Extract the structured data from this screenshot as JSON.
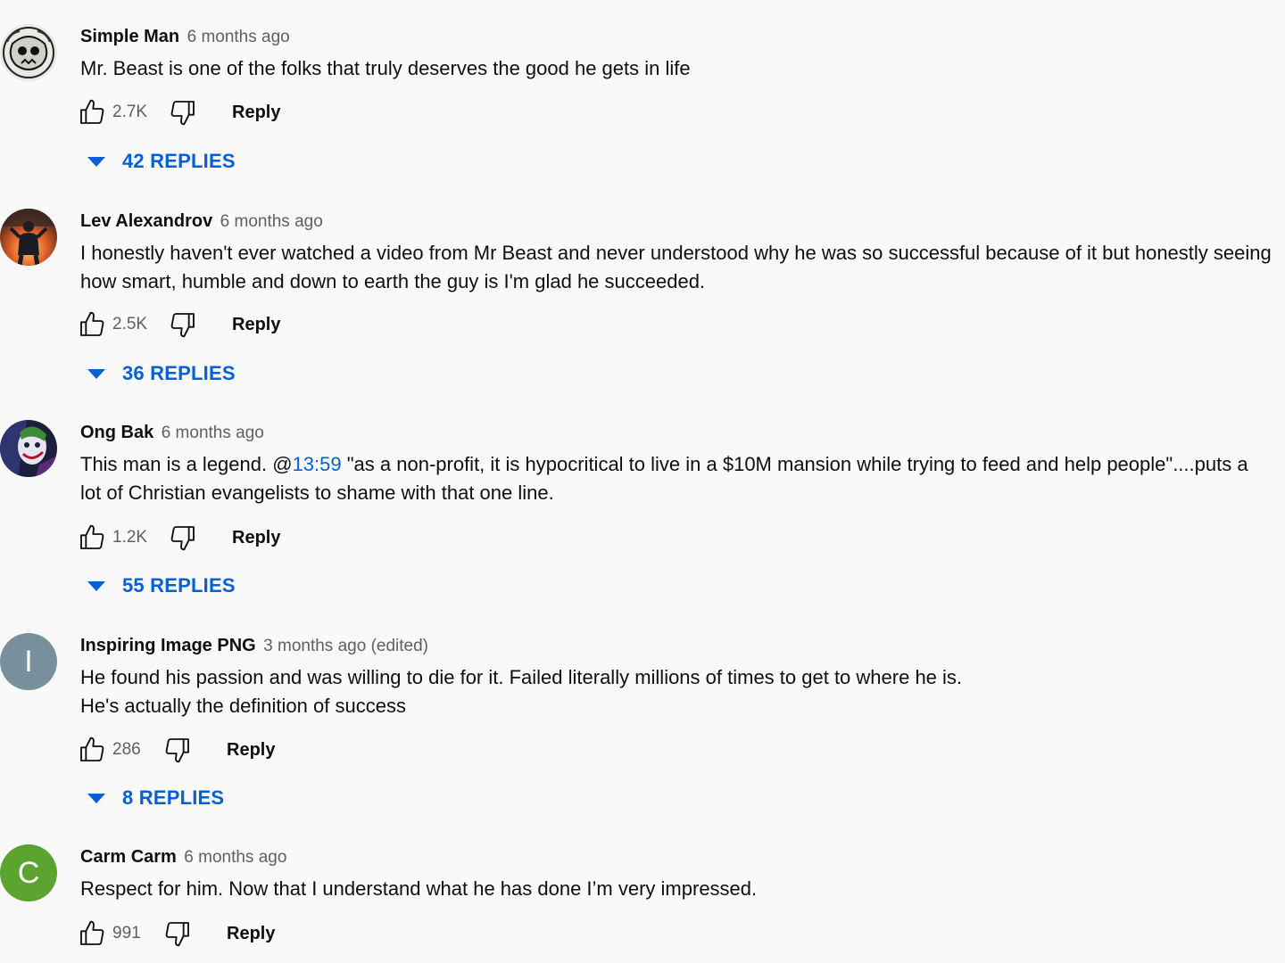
{
  "comments": [
    {
      "author": "Simple Man",
      "time": "6 months ago",
      "text_lines": [
        "Mr. Beast is one of the folks that truly deserves the good he gets in life"
      ],
      "likes": "2.7K",
      "reply_label": "Reply",
      "replies_label": "42 REPLIES",
      "avatar": "sketch-skull-avatar"
    },
    {
      "author": "Lev Alexandrov",
      "time": "6 months ago",
      "text_lines": [
        "I honestly haven't ever watched a video from Mr Beast and never understood why he was so successful because of it but honestly seeing",
        "how smart, humble and down to earth the guy is I'm glad he succeeded."
      ],
      "likes": "2.5K",
      "reply_label": "Reply",
      "replies_label": "36 REPLIES",
      "avatar": "fire-figure-avatar"
    },
    {
      "author": "Ong Bak",
      "time": "6 months ago",
      "text_prefix": "This man is a legend. @",
      "timestamp_link": "13:59",
      "text_suffix": " \"as a non-profit, it is hypocritical to live in a $10M mansion while trying to feed and help people\"....puts a",
      "text_line2": "lot of Christian evangelists to shame with that one line.",
      "likes": "1.2K",
      "reply_label": "Reply",
      "replies_label": "55 REPLIES",
      "avatar": "joker-avatar"
    },
    {
      "author": "Inspiring Image PNG",
      "time": "3 months ago (edited)",
      "text_lines": [
        "He found his passion and was willing to die for it. Failed literally millions of times to get to where he is.",
        "He's actually the definition of success"
      ],
      "likes": "286",
      "reply_label": "Reply",
      "replies_label": "8 REPLIES",
      "avatar_letter": "I",
      "avatar_color": "#78909c"
    },
    {
      "author": "Carm Carm",
      "time": "6 months ago",
      "text_lines": [
        "Respect for him. Now that I understand what he has done I’m very impressed."
      ],
      "likes": "991",
      "reply_label": "Reply",
      "avatar_letter": "C",
      "avatar_color": "#5ba430"
    }
  ],
  "colors": {
    "background": "#f9f9f9",
    "link_blue": "#065fd4",
    "secondary_text": "#606060"
  },
  "icons": [
    "thumbs-up-icon",
    "thumbs-down-icon",
    "caret-down-icon"
  ]
}
